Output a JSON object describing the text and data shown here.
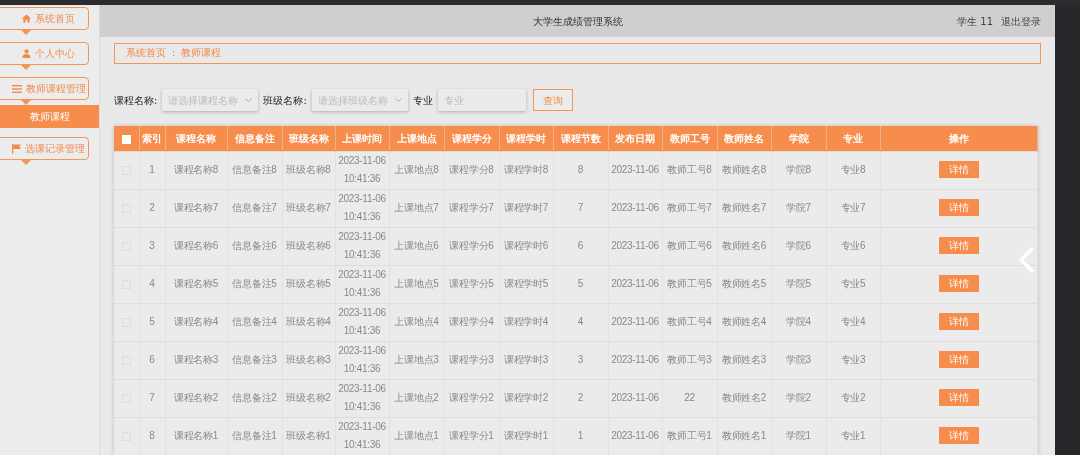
{
  "header": {
    "title": "大学生成绩管理系统",
    "user": "学生 11",
    "logout": "退出登录"
  },
  "sidebar": {
    "items": [
      {
        "label": "系统首页",
        "selected": false
      },
      {
        "label": "个人中心",
        "selected": false
      },
      {
        "label": "教师课程管理",
        "selected": false,
        "children": [
          {
            "label": "教师课程",
            "selected": true
          }
        ]
      },
      {
        "label": "选课记录管理",
        "selected": false
      }
    ]
  },
  "breadcrumb": {
    "home": "系统首页",
    "separator": ":",
    "current": "教师课程"
  },
  "search": {
    "fields": [
      {
        "kind": "select",
        "label": "课程名称:",
        "placeholder": "请选择课程名称"
      },
      {
        "kind": "select",
        "label": "班级名称:",
        "placeholder": "请选择班级名称"
      },
      {
        "kind": "input",
        "label": "专业",
        "placeholder": "专业"
      }
    ],
    "button": "查询"
  },
  "table": {
    "header_checked": false,
    "columns": [
      "索引",
      "课程名称",
      "信息备注",
      "班级名称",
      "上课时间",
      "上课地点",
      "课程学分",
      "课程学时",
      "课程节数",
      "发布日期",
      "教师工号",
      "教师姓名",
      "学院",
      "专业",
      "操作"
    ],
    "rows": [
      {
        "checked": false,
        "cells": [
          "1",
          "课程名称8",
          "信息备注8",
          "班级名称8",
          "2023-11-06\n10:41:36",
          "上课地点8",
          "课程学分8",
          "课程学时8",
          "8",
          "2023-11-06",
          "教师工号8",
          "教师姓名8",
          "学院8",
          "专业8"
        ],
        "action": "详情"
      },
      {
        "checked": false,
        "cells": [
          "2",
          "课程名称7",
          "信息备注7",
          "班级名称7",
          "2023-11-06\n10:41:36",
          "上课地点7",
          "课程学分7",
          "课程学时7",
          "7",
          "2023-11-06",
          "教师工号7",
          "教师姓名7",
          "学院7",
          "专业7"
        ],
        "action": "详情"
      },
      {
        "checked": false,
        "cells": [
          "3",
          "课程名称6",
          "信息备注6",
          "班级名称6",
          "2023-11-06\n10:41:36",
          "上课地点6",
          "课程学分6",
          "课程学时6",
          "6",
          "2023-11-06",
          "教师工号6",
          "教师姓名6",
          "学院6",
          "专业6"
        ],
        "action": "详情"
      },
      {
        "checked": false,
        "cells": [
          "4",
          "课程名称5",
          "信息备注5",
          "班级名称5",
          "2023-11-06\n10:41:36",
          "上课地点5",
          "课程学分5",
          "课程学时5",
          "5",
          "2023-11-06",
          "教师工号5",
          "教师姓名5",
          "学院5",
          "专业5"
        ],
        "action": "详情"
      },
      {
        "checked": false,
        "cells": [
          "5",
          "课程名称4",
          "信息备注4",
          "班级名称4",
          "2023-11-06\n10:41:36",
          "上课地点4",
          "课程学分4",
          "课程学时4",
          "4",
          "2023-11-06",
          "教师工号4",
          "教师姓名4",
          "学院4",
          "专业4"
        ],
        "action": "详情"
      },
      {
        "checked": false,
        "cells": [
          "6",
          "课程名称3",
          "信息备注3",
          "班级名称3",
          "2023-11-06\n10:41:36",
          "上课地点3",
          "课程学分3",
          "课程学时3",
          "3",
          "2023-11-06",
          "教师工号3",
          "教师姓名3",
          "学院3",
          "专业3"
        ],
        "action": "详情"
      },
      {
        "checked": false,
        "cells": [
          "7",
          "课程名称2",
          "信息备注2",
          "班级名称2",
          "2023-11-06\n10:41:36",
          "上课地点2",
          "课程学分2",
          "课程学时2",
          "2",
          "2023-11-06",
          "22",
          "教师姓名2",
          "学院2",
          "专业2"
        ],
        "action": "详情"
      },
      {
        "checked": false,
        "cells": [
          "8",
          "课程名称1",
          "信息备注1",
          "班级名称1",
          "2023-11-06\n10:41:36",
          "上课地点1",
          "课程学分1",
          "课程学时1",
          "1",
          "2023-11-06",
          "教师工号1",
          "教师姓名1",
          "学院1",
          "专业1"
        ],
        "action": "详情"
      }
    ]
  }
}
